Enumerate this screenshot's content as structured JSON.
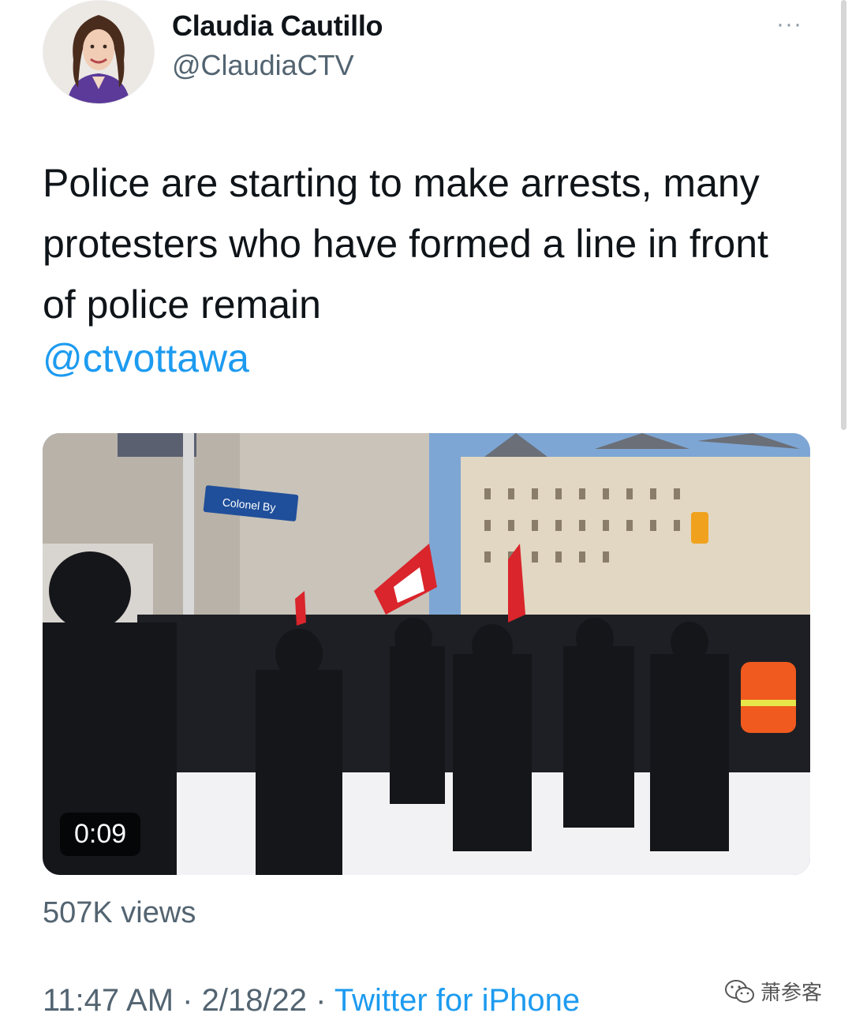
{
  "tweet": {
    "author_name": "Claudia Cautillo",
    "author_handle": "@ClaudiaCTV",
    "more_icon": "···",
    "text": "Police are starting to make arrests, many protesters who have formed a line in front of police remain",
    "mention": "@ctvottawa",
    "media": {
      "type": "video",
      "duration": "0:09",
      "street_sign": "Colonel By"
    },
    "views": "507K views",
    "timestamp": "11:47 AM · 2/18/22 · ",
    "source": "Twitter for iPhone"
  },
  "watermark": {
    "text": "萧参客",
    "icon": "wechat-icon"
  },
  "colors": {
    "link": "#1d9bf0",
    "secondary_text": "#536471",
    "primary_text": "#0f1419"
  }
}
